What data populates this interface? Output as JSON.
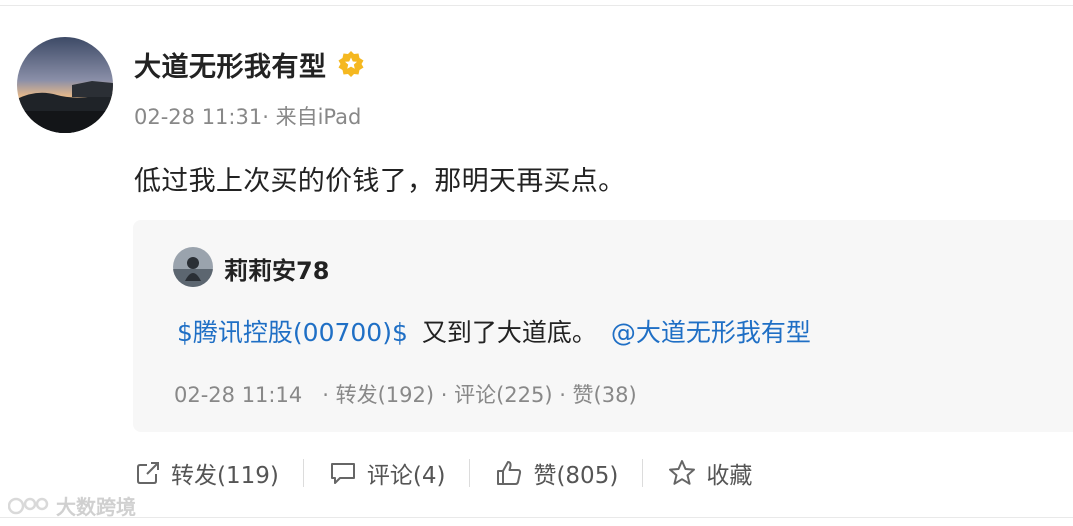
{
  "post": {
    "author_name": "大道无形我有型",
    "meta": "02-28 11:31· 来自iPad",
    "text": "低过我上次买的价钱了，那明天再买点。"
  },
  "repost": {
    "author_name": "莉莉安78",
    "stock_link": "$腾讯控股(00700)$",
    "text": "又到了大道底。",
    "mention": "@大道无形我有型",
    "time": "02-28 11:14",
    "stats": "· 转发(192) · 评论(225) · 赞(38)"
  },
  "actions": {
    "repost_label": "转发(119)",
    "comment_label": "评论(4)",
    "like_label": "赞(805)",
    "favorite_label": "收藏"
  },
  "watermark": "大数跨境",
  "colors": {
    "link": "#1f6fc5",
    "badge": "#f5b820",
    "meta_text": "#888888",
    "card_background": "#f7f7f7"
  }
}
